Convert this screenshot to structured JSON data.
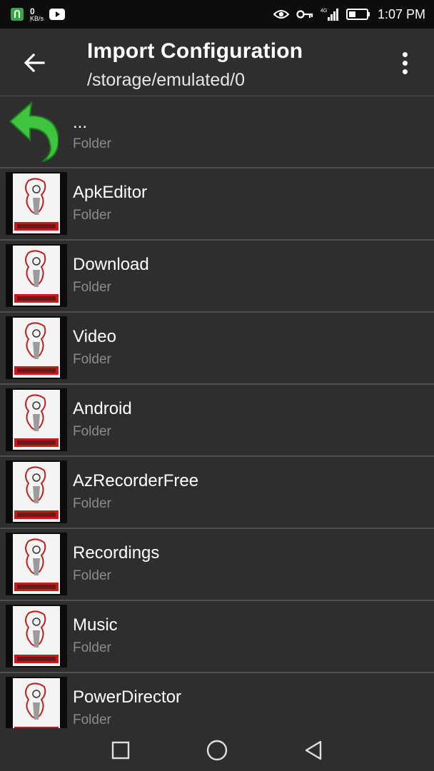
{
  "status_bar": {
    "net_speed_value": "0",
    "net_speed_unit": "KB/s",
    "network_type": "4G",
    "time": "1:07 PM",
    "icons": [
      "shield-app-icon",
      "youtube-icon",
      "eye-icon",
      "key-icon",
      "signal-icon",
      "battery-icon"
    ]
  },
  "app_bar": {
    "title": "Import Configuration",
    "subtitle": "/storage/emulated/0"
  },
  "list": {
    "up": {
      "name": "...",
      "type": "Folder"
    },
    "items": [
      {
        "name": "ApkEditor",
        "type": "Folder"
      },
      {
        "name": "Download",
        "type": "Folder"
      },
      {
        "name": "Video",
        "type": "Folder"
      },
      {
        "name": "Android",
        "type": "Folder"
      },
      {
        "name": "AzRecorderFree",
        "type": "Folder"
      },
      {
        "name": "Recordings",
        "type": "Folder"
      },
      {
        "name": "Music",
        "type": "Folder"
      },
      {
        "name": "PowerDirector",
        "type": "Folder"
      }
    ]
  },
  "colors": {
    "background": "#2e2e2e",
    "status_bar": "#0d0d0d",
    "divider": "#505050",
    "secondary_text": "#8c8c8c",
    "up_arrow": "#3ec43e"
  }
}
